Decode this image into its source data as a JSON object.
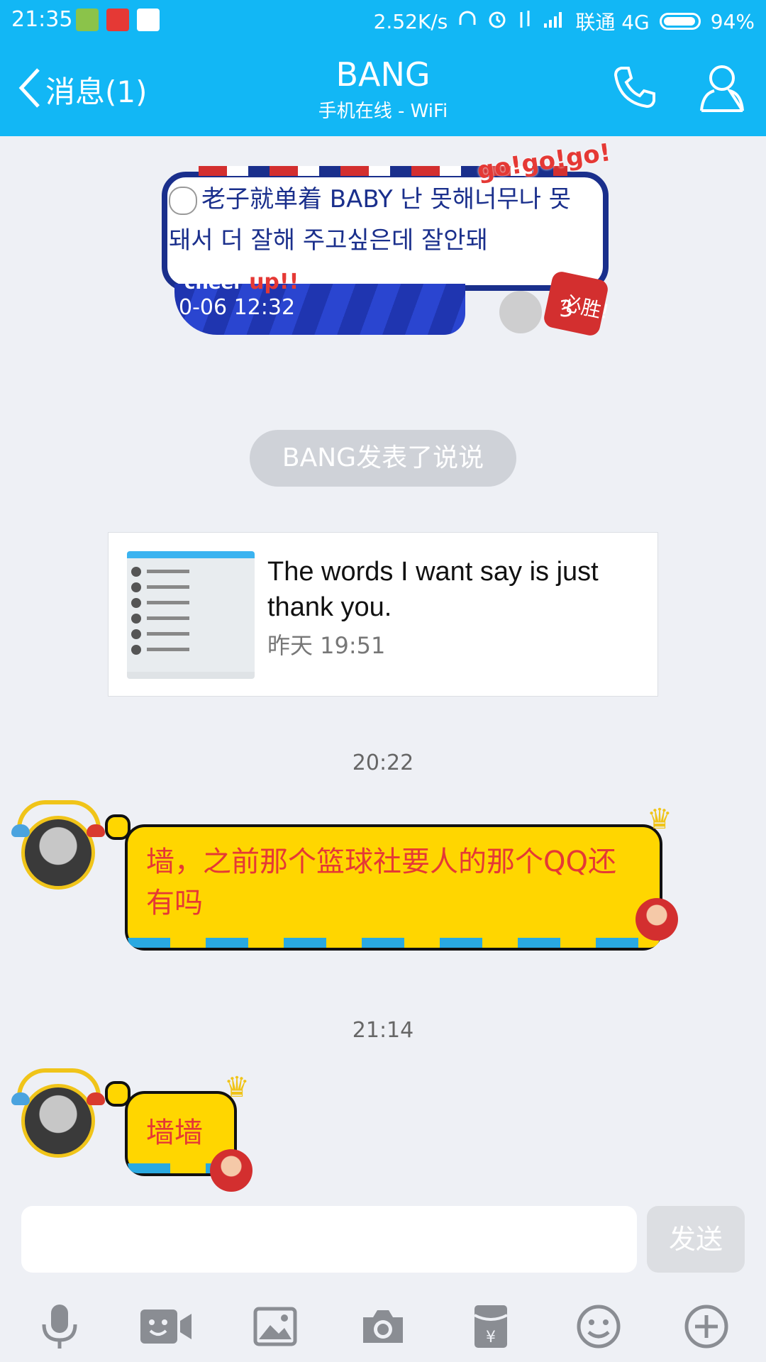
{
  "status_bar": {
    "time": "21:35",
    "speed": "2.52K/s",
    "carrier": "联通 4G",
    "battery": "94%"
  },
  "header": {
    "back_label": "消息(1)",
    "title": "BANG",
    "subtitle": "手机在线 - WiFi"
  },
  "top_message": {
    "text": "老子就单着 BABY 난 못해너무나 못돼서 더 잘해 주고싶은데 잘안돼",
    "time": "0-06 12:32",
    "like_count": "3",
    "sticker_gogo": "go!go!go!",
    "sticker_cheer": "cheer",
    "sticker_up": "up!!",
    "badge": "必胜!"
  },
  "notice": {
    "text": "BANG发表了说说"
  },
  "shared_card": {
    "text": "The words I want say is just thank you.",
    "time": "昨天 19:51"
  },
  "timestamps": [
    "20:22",
    "21:14"
  ],
  "messages": [
    {
      "text": "墙，之前那个篮球社要人的那个QQ还有吗"
    },
    {
      "text": "墙墙"
    }
  ],
  "input": {
    "value": "",
    "placeholder": ""
  },
  "send_label": "发送",
  "toolbar_icons": [
    "microphone-icon",
    "video-icon",
    "image-icon",
    "camera-icon",
    "red-packet-icon",
    "emoji-icon",
    "plus-icon"
  ],
  "colors": {
    "header_bg": "#12b7f5",
    "bubble_yellow": "#ffd600",
    "bubble_text": "#e53935",
    "background": "#eef0f5"
  }
}
